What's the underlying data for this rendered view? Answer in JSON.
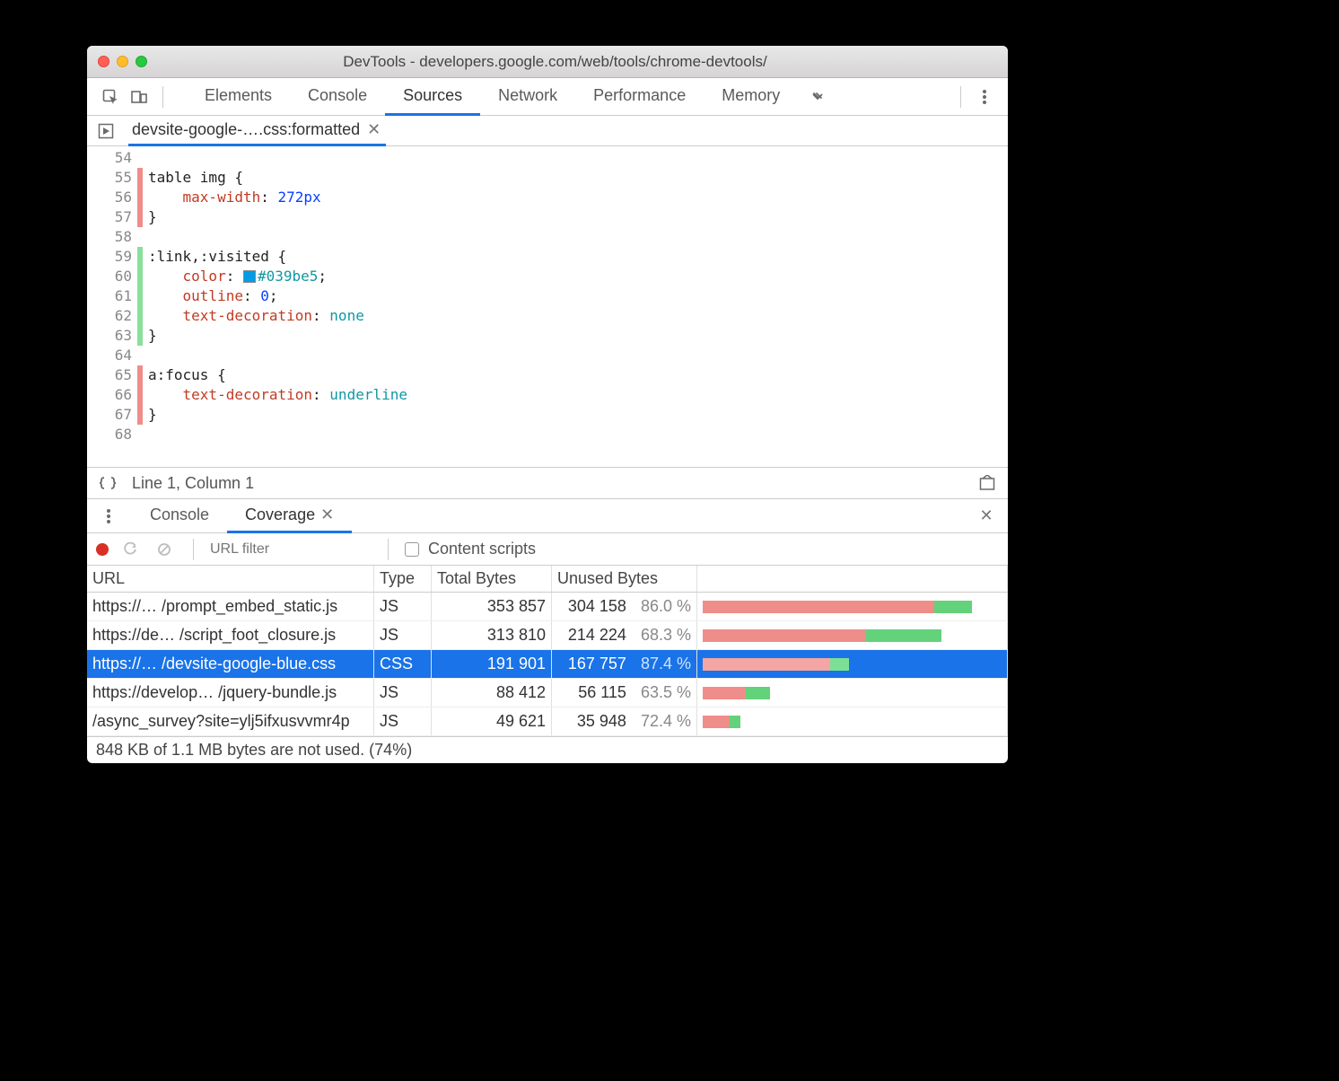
{
  "window": {
    "title": "DevTools - developers.google.com/web/tools/chrome-devtools/"
  },
  "main_tabs": [
    "Elements",
    "Console",
    "Sources",
    "Network",
    "Performance",
    "Memory"
  ],
  "main_tab_active": "Sources",
  "file_tab": {
    "label": "devsite-google-….css:formatted"
  },
  "code": {
    "lines": [
      {
        "n": 54,
        "cov": "",
        "html": ""
      },
      {
        "n": 55,
        "cov": "r",
        "html": "<span class='tok-sel'>table img</span> {"
      },
      {
        "n": 56,
        "cov": "r",
        "html": "    <span class='tok-prop'>max-width</span>: <span class='tok-val'>272px</span>"
      },
      {
        "n": 57,
        "cov": "r",
        "html": "}"
      },
      {
        "n": 58,
        "cov": "",
        "html": ""
      },
      {
        "n": 59,
        "cov": "g",
        "html": "<span class='tok-sel'>:link,:visited</span> {"
      },
      {
        "n": 60,
        "cov": "g",
        "html": "    <span class='tok-prop'>color</span>: <span class='swatch'></span><span class='tok-col'>#039be5</span>;"
      },
      {
        "n": 61,
        "cov": "g",
        "html": "    <span class='tok-prop'>outline</span>: <span class='tok-val'>0</span>;"
      },
      {
        "n": 62,
        "cov": "g",
        "html": "    <span class='tok-prop'>text-decoration</span>: <span class='tok-val2'>none</span>"
      },
      {
        "n": 63,
        "cov": "g",
        "html": "}"
      },
      {
        "n": 64,
        "cov": "",
        "html": ""
      },
      {
        "n": 65,
        "cov": "r",
        "html": "<span class='tok-sel'>a:focus</span> {"
      },
      {
        "n": 66,
        "cov": "r",
        "html": "    <span class='tok-prop'>text-decoration</span>: <span class='tok-val2'>underline</span>"
      },
      {
        "n": 67,
        "cov": "r",
        "html": "}"
      },
      {
        "n": 68,
        "cov": "",
        "html": ""
      }
    ],
    "status": "Line 1, Column 1"
  },
  "drawer_tabs": [
    "Console",
    "Coverage"
  ],
  "drawer_tab_active": "Coverage",
  "coverage_toolbar": {
    "url_filter_placeholder": "URL filter",
    "content_scripts_label": "Content scripts"
  },
  "coverage_table": {
    "headers": {
      "url": "URL",
      "type": "Type",
      "total": "Total Bytes",
      "unused": "Unused Bytes"
    },
    "max_total": 353857,
    "rows": [
      {
        "url": "https://… /prompt_embed_static.js",
        "type": "JS",
        "total": "353 857",
        "unused": "304 158",
        "pct": "86.0 %",
        "total_n": 353857,
        "unused_n": 304158
      },
      {
        "url": "https://de… /script_foot_closure.js",
        "type": "JS",
        "total": "313 810",
        "unused": "214 224",
        "pct": "68.3 %",
        "total_n": 313810,
        "unused_n": 214224
      },
      {
        "url": "https://… /devsite-google-blue.css",
        "type": "CSS",
        "total": "191 901",
        "unused": "167 757",
        "pct": "87.4 %",
        "total_n": 191901,
        "unused_n": 167757,
        "selected": true
      },
      {
        "url": "https://develop… /jquery-bundle.js",
        "type": "JS",
        "total": "88 412",
        "unused": "56 115",
        "pct": "63.5 %",
        "total_n": 88412,
        "unused_n": 56115
      },
      {
        "url": "/async_survey?site=ylj5ifxusvvmr4p",
        "type": "JS",
        "total": "49 621",
        "unused": "35 948",
        "pct": "72.4 %",
        "total_n": 49621,
        "unused_n": 35948
      }
    ],
    "footer": "848 KB of 1.1 MB bytes are not used. (74%)"
  }
}
